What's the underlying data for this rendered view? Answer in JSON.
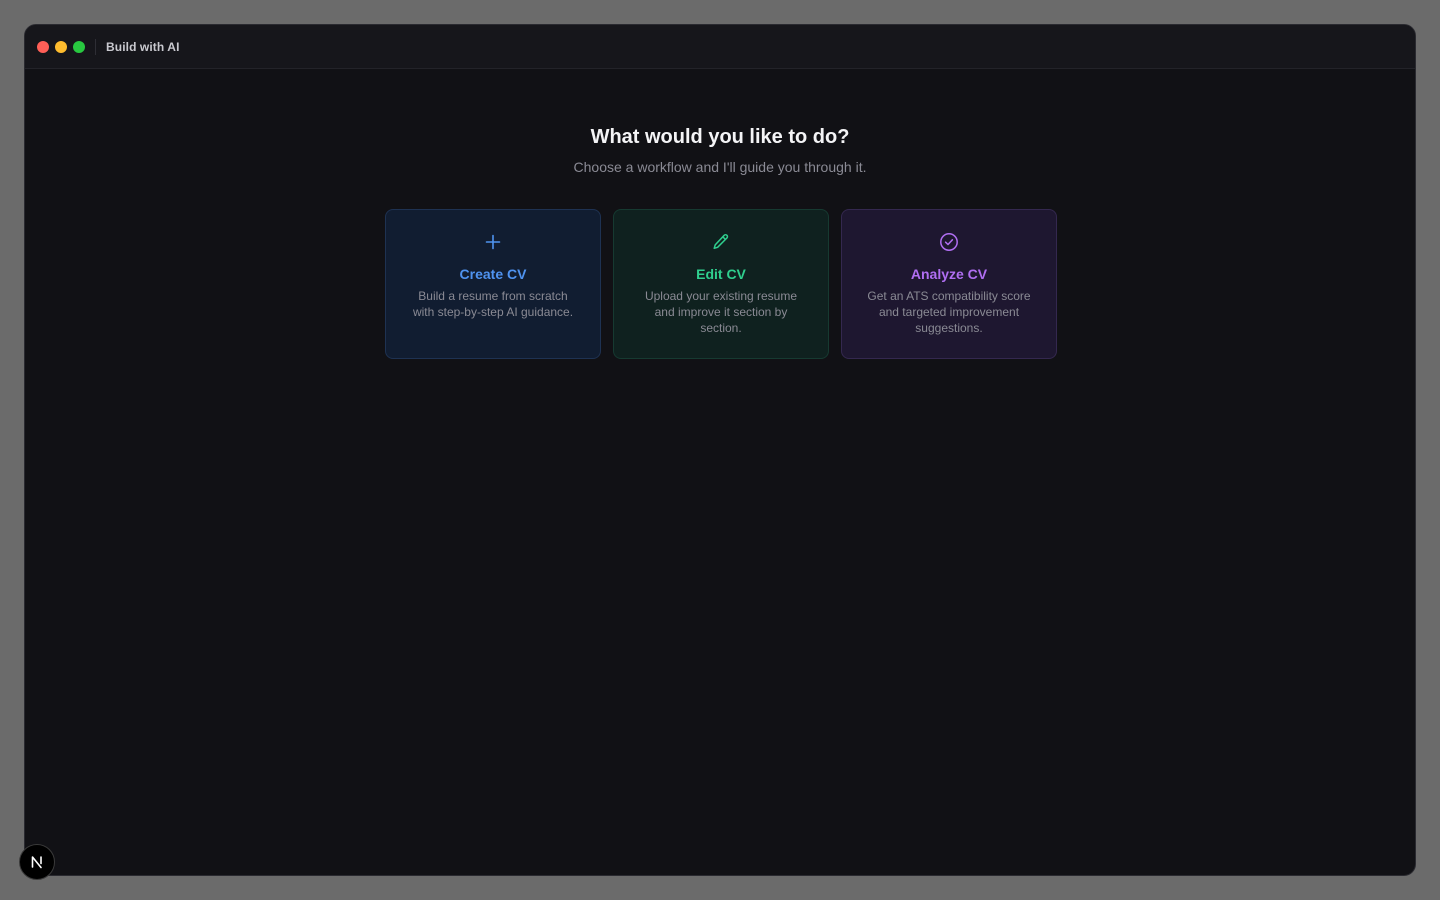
{
  "window": {
    "title": "Build with AI"
  },
  "main": {
    "heading": "What would you like to do?",
    "subheading": "Choose a workflow and I'll guide you through it."
  },
  "cards": [
    {
      "title": "Create CV",
      "description": "Build a resume from scratch with step-by-step AI guidance.",
      "icon": "plus-icon",
      "color": "#4f93f0"
    },
    {
      "title": "Edit CV",
      "description": "Upload your existing resume and improve it section by section.",
      "icon": "pencil-icon",
      "color": "#2fcf8e"
    },
    {
      "title": "Analyze CV",
      "description": "Get an ATS compatibility score and targeted improvement suggestions.",
      "icon": "check-circle-icon",
      "color": "#b06ef2"
    }
  ],
  "dev_badge": {
    "letter": "N",
    "icon": "nextjs-logo-icon"
  }
}
